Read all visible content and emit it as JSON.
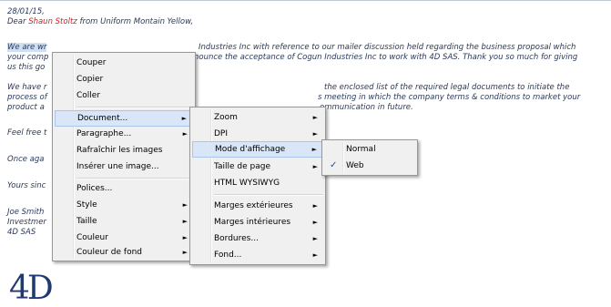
{
  "letter": {
    "date": "28/01/15,",
    "greet_a": "Dear ",
    "greet_name": "Shaun Stoltz",
    "greet_b": " from Uniform Montain Yellow,",
    "p1_a": "We are wr",
    "p1_b": "Industries Inc with reference to our mailer discussion held regarding the business proposal which",
    "p1_c": "your comp",
    "p1_d": "nounce the acceptance of Cogun Industries Inc to work with 4D SAS. Thank you so much for giving",
    "p1_e": "us this go",
    "p2_a": "We have r",
    "p2_b": "the enclosed list of the required legal documents to initiate the",
    "p2_c": "process of",
    "p2_d": "s meeting in which the company terms & conditions to market your",
    "p2_e": "product a",
    "p2_f": "ommunication in future.",
    "l_feel": "Feel free t",
    "l_once": "Once aga",
    "l_yours": "Yours sinc",
    "l_joe": "Joe Smith",
    "l_invest": "Investmer",
    "l_company": "4D SAS",
    "logo": "4D"
  },
  "menu_main": {
    "items": [
      "Couper",
      "Copier",
      "Coller",
      "Document...",
      "Paragraphe...",
      "Rafraîchir les images",
      "Insérer une image...",
      "Polices...",
      "Style",
      "Taille",
      "Couleur",
      "Couleur de fond"
    ]
  },
  "menu_document": {
    "items": [
      "Zoom",
      "DPI",
      "Mode d'affichage",
      "Taille de page",
      "HTML WYSIWYG",
      "Marges extérieures",
      "Marges intérieures",
      "Bordures...",
      "Fond..."
    ]
  },
  "menu_mode": {
    "items": [
      "Normal",
      "Web"
    ],
    "checked_glyph": "✓"
  },
  "glyphs": {
    "submenu_arrow": "►"
  },
  "colors": {
    "highlight": "#d8e6f7",
    "text_red": "#cc2222",
    "text_blue": "#2a3a5a",
    "logo": "#1f3a70"
  }
}
